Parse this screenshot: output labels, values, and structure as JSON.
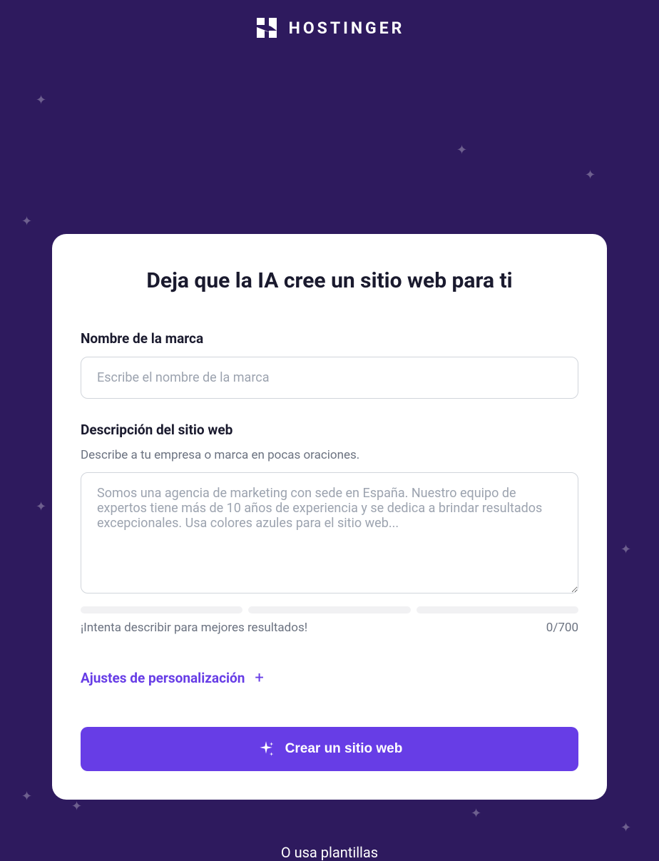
{
  "header": {
    "logo_text": "HOSTINGER"
  },
  "card": {
    "title": "Deja que la IA cree un sitio web para ti",
    "brand_name": {
      "label": "Nombre de la marca",
      "placeholder": "Escribe el nombre de la marca",
      "value": ""
    },
    "description": {
      "label": "Descripción del sitio web",
      "help_text": "Describe a tu empresa o marca en pocas oraciones.",
      "placeholder": "Somos una agencia de marketing con sede en España. Nuestro equipo de expertos tiene más de 10 años de experiencia y se dedica a brindar resultados excepcionales. Usa colores azules para el sitio web...",
      "value": "",
      "hint": "¡Intenta describir para mejores resultados!",
      "counter": "0/700"
    },
    "settings_label": "Ajustes de personalización",
    "create_button_label": "Crear un sitio web"
  },
  "footer": {
    "text": "O usa plantillas"
  }
}
